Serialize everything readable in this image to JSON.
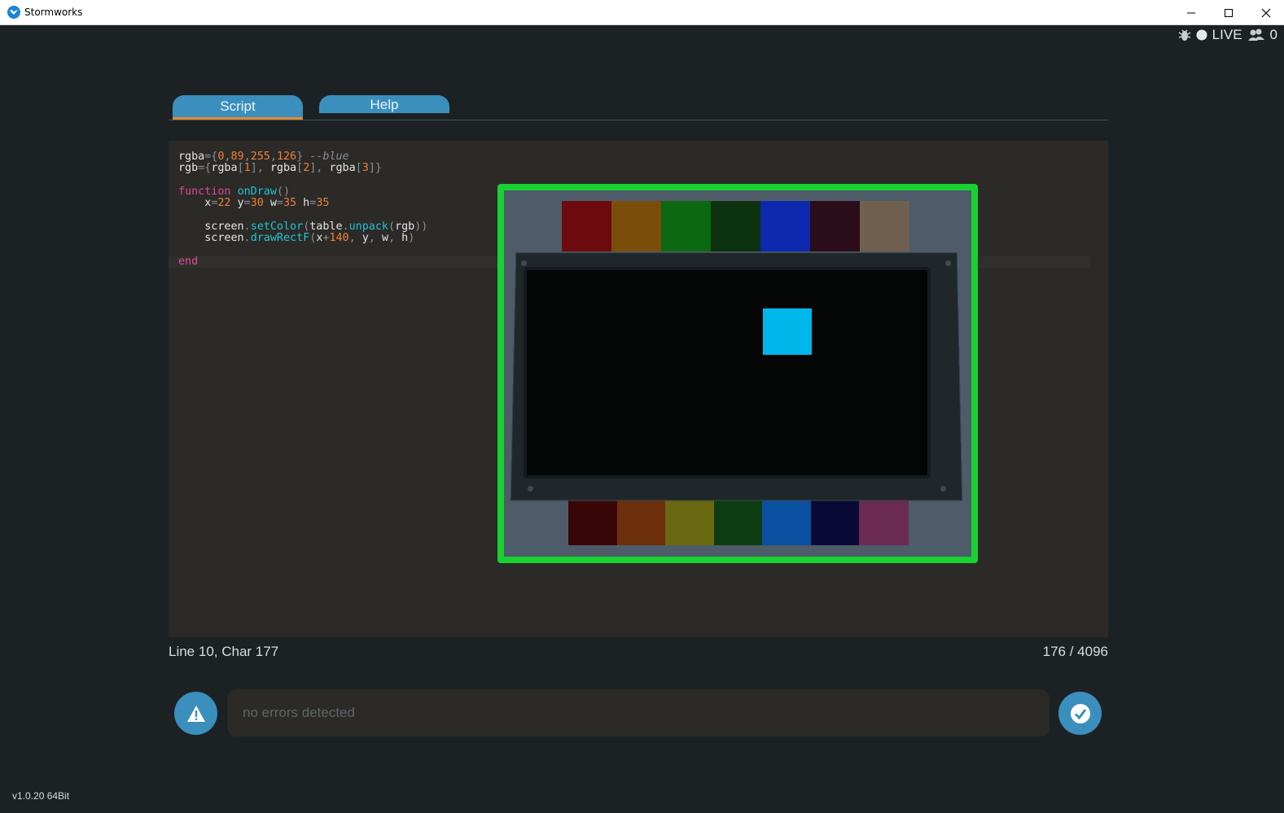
{
  "window": {
    "title": "Stormworks",
    "controls": [
      "minimize",
      "maximize",
      "close"
    ]
  },
  "status": {
    "live_label": "LIVE",
    "players_count": "0"
  },
  "tabs": [
    {
      "label": "Script",
      "active": true
    },
    {
      "label": "Help",
      "active": false
    }
  ],
  "editor": {
    "lines": [
      [
        [
          "plain",
          "rgba"
        ],
        [
          "op",
          "={"
        ],
        [
          "num",
          "0"
        ],
        [
          "op",
          ","
        ],
        [
          "num",
          "89"
        ],
        [
          "op",
          ","
        ],
        [
          "num",
          "255"
        ],
        [
          "op",
          ","
        ],
        [
          "num",
          "126"
        ],
        [
          "op",
          "} "
        ],
        [
          "cm",
          "--blue"
        ]
      ],
      [
        [
          "plain",
          "rgb"
        ],
        [
          "op",
          "={"
        ],
        [
          "plain",
          "rgba"
        ],
        [
          "op",
          "["
        ],
        [
          "num",
          "1"
        ],
        [
          "op",
          "], "
        ],
        [
          "plain",
          "rgba"
        ],
        [
          "op",
          "["
        ],
        [
          "num",
          "2"
        ],
        [
          "op",
          "], "
        ],
        [
          "plain",
          "rgba"
        ],
        [
          "op",
          "["
        ],
        [
          "num",
          "3"
        ],
        [
          "op",
          "]}"
        ]
      ],
      [],
      [
        [
          "kw",
          "function "
        ],
        [
          "fn",
          "onDraw"
        ],
        [
          "op",
          "()"
        ]
      ],
      [
        [
          "plain",
          "    x"
        ],
        [
          "op",
          "="
        ],
        [
          "num",
          "22"
        ],
        [
          "plain",
          " y"
        ],
        [
          "op",
          "="
        ],
        [
          "num",
          "30"
        ],
        [
          "plain",
          " w"
        ],
        [
          "op",
          "="
        ],
        [
          "num",
          "35"
        ],
        [
          "plain",
          " h"
        ],
        [
          "op",
          "="
        ],
        [
          "num",
          "35"
        ]
      ],
      [],
      [
        [
          "plain",
          "    screen"
        ],
        [
          "op",
          "."
        ],
        [
          "fn",
          "setColor"
        ],
        [
          "op",
          "("
        ],
        [
          "plain",
          "table"
        ],
        [
          "op",
          "."
        ],
        [
          "fn",
          "unpack"
        ],
        [
          "op",
          "("
        ],
        [
          "plain",
          "rgb"
        ],
        [
          "op",
          "))"
        ]
      ],
      [
        [
          "plain",
          "    screen"
        ],
        [
          "op",
          "."
        ],
        [
          "fn",
          "drawRectF"
        ],
        [
          "op",
          "("
        ],
        [
          "plain",
          "x"
        ],
        [
          "op",
          "+"
        ],
        [
          "num",
          "140"
        ],
        [
          "op",
          ", "
        ],
        [
          "plain",
          "y"
        ],
        [
          "op",
          ", "
        ],
        [
          "plain",
          "w"
        ],
        [
          "op",
          ", "
        ],
        [
          "plain",
          "h"
        ],
        [
          "op",
          ")"
        ]
      ],
      [],
      [
        [
          "kw",
          "end"
        ]
      ]
    ],
    "cursor_info": "Line 10, Char 177",
    "char_count": "176 / 4096"
  },
  "preview": {
    "top_swatches": [
      "#6d0a0d",
      "#7a4d0b",
      "#0b6912",
      "#0d3210",
      "#0c29b0",
      "#2b0d1a",
      "#6f6050"
    ],
    "bottom_swatches": [
      "#3a0709",
      "#6c300c",
      "#6a6811",
      "#0d3d12",
      "#0b4fa0",
      "#090a35",
      "#6a2a52"
    ],
    "drawn_rect_color": "#00b7eb"
  },
  "errors": {
    "message": "no errors detected"
  },
  "version": "v1.0.20 64Bit",
  "colors": {
    "accent": "#3a8fbd",
    "preview_border": "#19d131",
    "tab_underline": "#e08a2e"
  }
}
